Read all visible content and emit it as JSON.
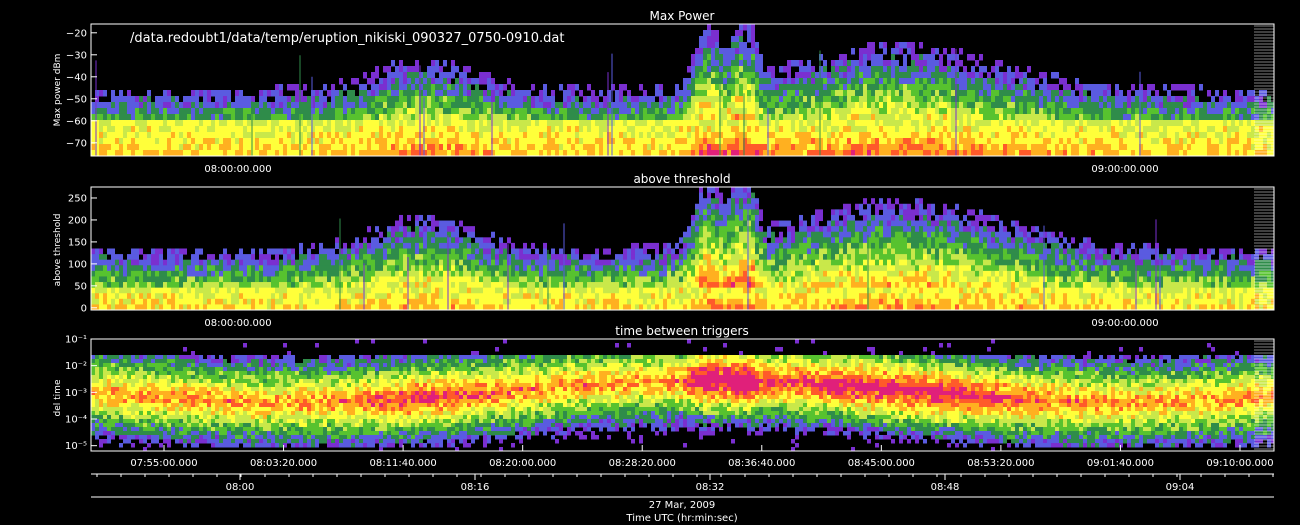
{
  "file_label": "/data.redoubt1/data/temp/eruption_nikiski_090327_0750-0910.dat",
  "chart_data": [
    {
      "type": "heatmap",
      "title": "Max Power",
      "ylabel": "Max power dBm",
      "scale": "linear",
      "ylim": [
        -76,
        -16
      ],
      "yticks": [
        -20,
        -30,
        -40,
        -50,
        -60,
        -70
      ],
      "ytick_labels": [
        "−20",
        "−30",
        "−40",
        "−50",
        "−60",
        "−70"
      ],
      "xtick_labels": [
        "08:00:00.000",
        "09:00:00.000"
      ]
    },
    {
      "type": "heatmap",
      "title": "above threshold",
      "ylabel": "above threshold",
      "scale": "linear",
      "ylim": [
        -5,
        275
      ],
      "yticks": [
        0,
        50,
        100,
        150,
        200,
        250
      ],
      "ytick_labels": [
        "0",
        "50",
        "100",
        "150",
        "200",
        "250"
      ],
      "xtick_labels": [
        "08:00:00.000",
        "09:00:00.000"
      ]
    },
    {
      "type": "heatmap",
      "title": "time between triggers",
      "ylabel": "del time",
      "scale": "log",
      "ylim": [
        -5.2,
        -1
      ],
      "yticks": [
        -1,
        -2,
        -3,
        -4,
        -5
      ],
      "ytick_labels": [
        "10⁻¹",
        "10⁻²",
        "10⁻³",
        "10⁻⁴",
        "10⁻⁵"
      ],
      "xtick_labels": [
        "07:55:00.000",
        "08:03:20.000",
        "08:11:40.000",
        "08:20:00.000",
        "08:28:20.000",
        "08:36:40.000",
        "08:45:00.000",
        "08:53:20.000",
        "09:01:40.000",
        "09:10:00.000"
      ]
    }
  ],
  "bottom_axis": {
    "tick_labels": [
      "08:00",
      "08:16",
      "08:32",
      "08:48",
      "09:04"
    ],
    "date": "27 Mar, 2009",
    "label": "Time UTC (hr:min:sec)"
  }
}
